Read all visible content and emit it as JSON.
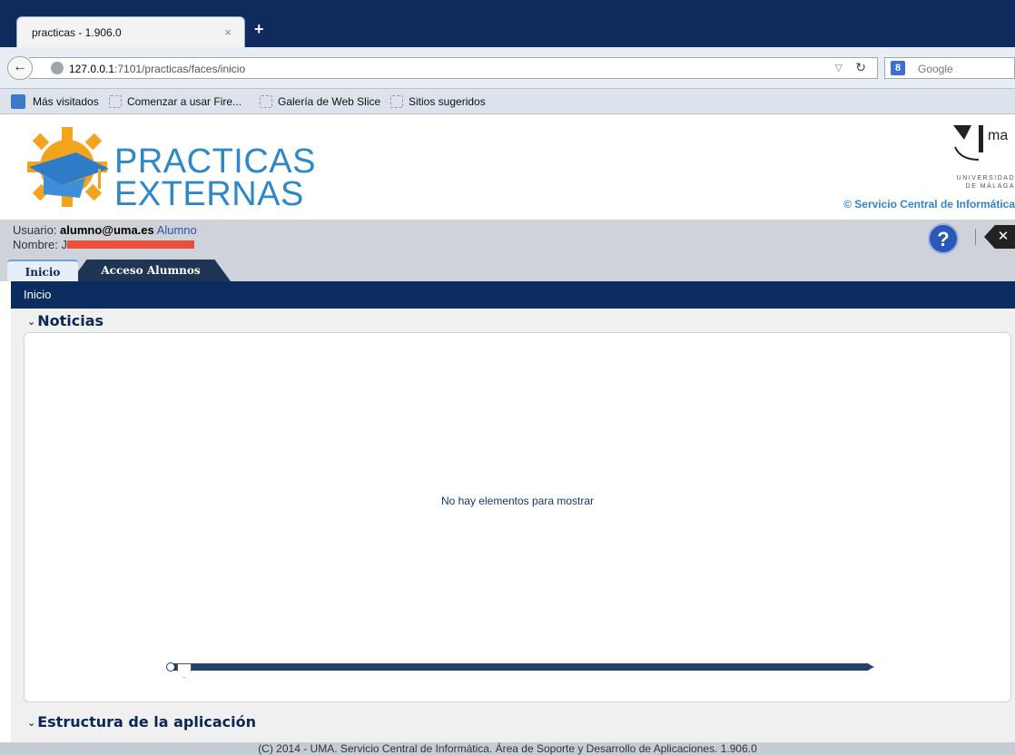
{
  "browser": {
    "tab_title": "practicas - 1.906.0",
    "tab_close": "×",
    "new_tab": "+",
    "url_host": "127.0.0.1",
    "url_rest": ":7101/practicas/faces/inicio",
    "search_placeholder": "Google",
    "bookmarks": [
      "Más visitados",
      "Comenzar a usar Fire...",
      "Galería de Web Slice",
      "Sitios sugeridos"
    ]
  },
  "header": {
    "logo_line1": "PRACTICAS",
    "logo_line2": "EXTERNAS",
    "uma_mark": "ma",
    "uma_sub1": "UNIVERSIDAD",
    "uma_sub2": "DE MÁLAGA",
    "sci_link": "© Servicio Central de Informática"
  },
  "user": {
    "usuario_label": "Usuario:",
    "email": "alumno@uma.es",
    "role": "Alumno",
    "nombre_label": "Nombre:",
    "nombre_value": "J"
  },
  "tabs": [
    "Inicio",
    "Acceso Alumnos"
  ],
  "breadcrumb": "Inicio",
  "sections": {
    "noticias": "Noticias",
    "empty_message": "No hay elementos para mostrar",
    "estructura": "Estructura de la aplicación"
  },
  "footer": "(C) 2014 - UMA. Servicio Central de Informática. Área de Soporte y Desarrollo de Aplicaciones. 1.906.0",
  "colors": {
    "navy": "#0b2c5e",
    "logo_blue": "#2e88c8",
    "link_blue": "#2855a8"
  }
}
